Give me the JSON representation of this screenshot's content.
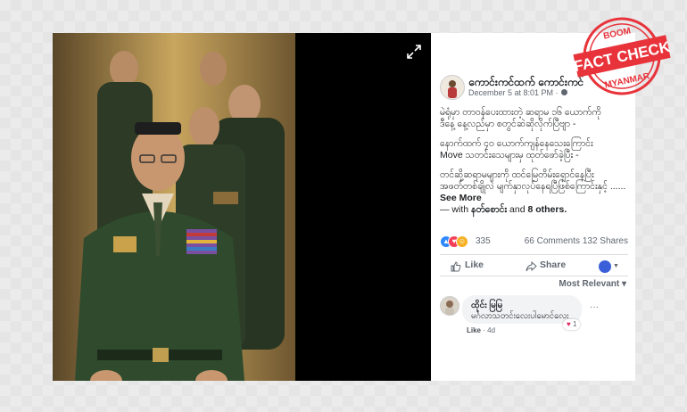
{
  "post": {
    "author": "ကောင်းကင်ထက် ကောင်းကင်",
    "date": "December 5 at 8:01 PM ·",
    "paragraphs": [
      "မဲရုံမှာ တာဝန်ပေးထားတဲ့ ဆရာမ ၁၆ ယောက်ကို",
      "ဒီနေ့ နေ့လည်မှာ စတွင်ဆဲဆိုလိုက်ပြီဗျာ -",
      "နောက်ထက် ၄၀ ယောက်ကျန်နေသေးကြောင်း",
      "Move သတင်းသေများမှ ထုတ်ဖော်ခဲ့ပြီး -",
      "တင်ဆို့ဆရာမများကို ထင်မြေတိမ်းရှောင်နေပြီး",
      "အဖတ်တစ်ချိုလဲ မျက်နှာလုပ်နေရပြီဖြစ်ကြောင်းနှင့် ......"
    ],
    "see_more": "See More",
    "with_prefix": "— with",
    "with_person": "နတ်စောင်း",
    "with_and": "and",
    "with_others": "8 others."
  },
  "stats": {
    "reaction_count": "335",
    "comments": "66 Comments",
    "shares": "132 Shares"
  },
  "actions": {
    "like": "Like",
    "share": "Share"
  },
  "comments": {
    "sort_label": "Most Relevant ▾",
    "items": [
      {
        "name": "ထိုင်း မြမြ",
        "body": "မင်္ဂလာသတင်းလေးပါမောင်လေး",
        "reaction_count": "1",
        "like": "Like",
        "age": "· 4d"
      }
    ]
  },
  "stamp": {
    "top": "BOOM",
    "main": "FACT CHECK",
    "bottom": "MYANMAR"
  },
  "colors": {
    "stamp_red": "#e8333b",
    "audience_blue": "#3b5fd9",
    "uniform_green": "#2f4a2c"
  },
  "icons": [
    "expand-icon",
    "like-icon",
    "share-icon",
    "globe-icon",
    "heart-icon"
  ]
}
